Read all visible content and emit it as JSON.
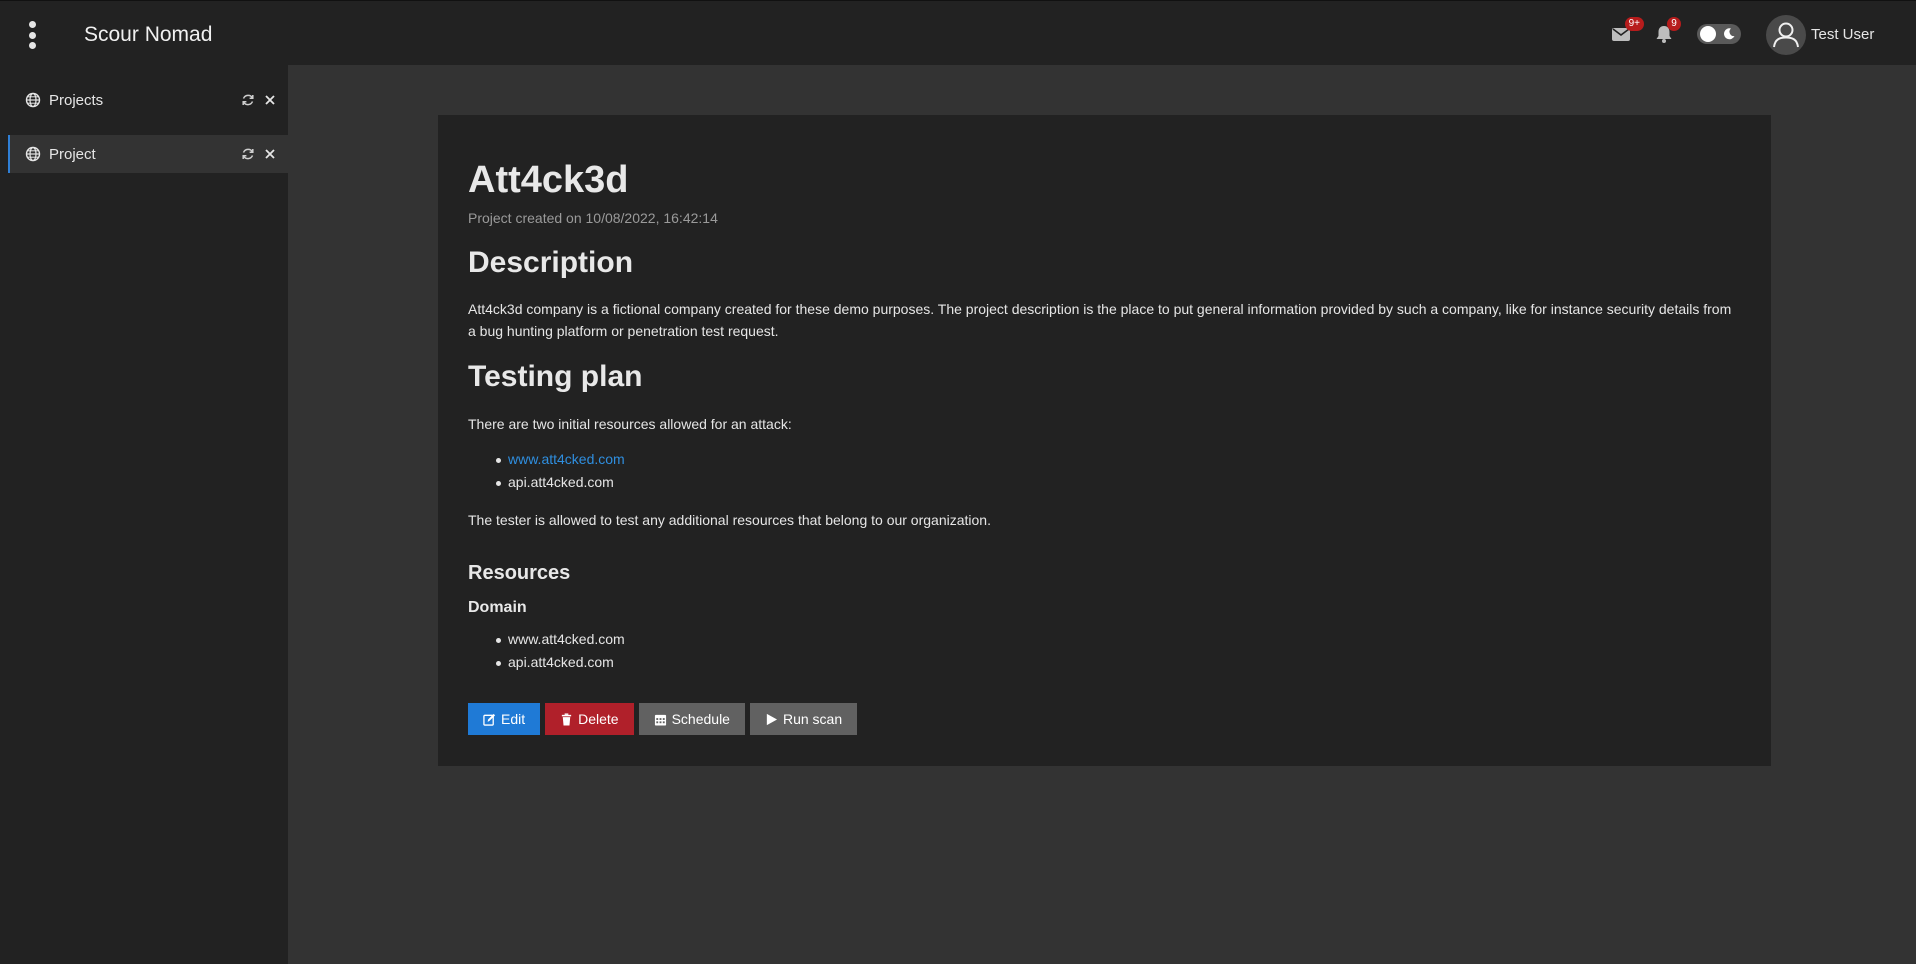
{
  "header": {
    "app_title": "Scour Nomad",
    "messages_badge": "9+",
    "notifications_badge": "9",
    "user_name": "Test User"
  },
  "sidebar": {
    "items": [
      {
        "label": "Projects",
        "icon": "globe-icon",
        "active": false
      },
      {
        "label": "Project",
        "icon": "globe-icon",
        "active": true
      }
    ]
  },
  "project": {
    "title": "Att4ck3d",
    "created": "Project created on 10/08/2022, 16:42:14",
    "description_heading": "Description",
    "description": "Att4ck3d company is a fictional company created for these demo purposes. The project description is the place to put general information provided by such a company, like for instance security details from a bug hunting platform or penetration test request.",
    "testing_heading": "Testing plan",
    "testing_intro": "There are two initial resources allowed for an attack:",
    "testing_resources": [
      "www.att4cked.com",
      "api.att4cked.com"
    ],
    "testing_note": "The tester is allowed to test any additional resources that belong to our organization.",
    "resources_heading": "Resources",
    "domain_heading": "Domain",
    "domains": [
      "www.att4cked.com",
      "api.att4cked.com"
    ]
  },
  "actions": {
    "edit": "Edit",
    "delete": "Delete",
    "schedule": "Schedule",
    "run_scan": "Run scan"
  },
  "colors": {
    "accent": "#1f7ad6",
    "danger": "#b0202a",
    "secondary": "#616161",
    "link": "#2f8fe0",
    "badge": "#b71c1c"
  }
}
